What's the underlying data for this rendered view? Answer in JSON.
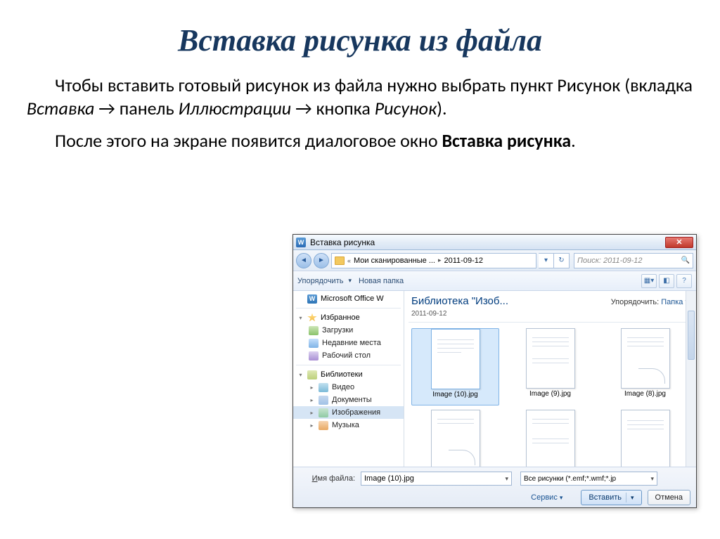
{
  "title": "Вставка рисунка из файла",
  "para1": {
    "t1": "Чтобы вставить готовый рисунок из файла нужно выбрать пункт Рисунок (вкладка ",
    "i1": "Вставка",
    "arrow1": " → панель ",
    "i2": "Иллюстрации",
    "arrow2": " → кнопка ",
    "i3": "Рисунок",
    "t2": ")."
  },
  "para2": {
    "t1": "После этого на экране появится диалоговое окно ",
    "b1": "Вставка рисунка",
    "t2": "."
  },
  "dialog": {
    "title": "Вставка рисунка",
    "path": {
      "crumb1": "Мои сканированные ...",
      "crumb2": "2011-09-12"
    },
    "search_placeholder": "Поиск: 2011-09-12",
    "toolbar": {
      "organize": "Упорядочить",
      "newfolder": "Новая папка"
    },
    "sidebar": {
      "msword": "Microsoft Office W",
      "fav": "Избранное",
      "downloads": "Загрузки",
      "recent": "Недавние места",
      "desktop": "Рабочий стол",
      "libraries": "Библиотеки",
      "video": "Видео",
      "documents": "Документы",
      "images": "Изображения",
      "music": "Музыка"
    },
    "content": {
      "header": "Библиотека \"Изоб...",
      "sub": "2011-09-12",
      "sort_label": "Упорядочить:",
      "sort_value": "Папка"
    },
    "files": [
      "Image (10).jpg",
      "Image (9).jpg",
      "Image (8).jpg",
      "",
      "",
      ""
    ],
    "footer": {
      "fname_label": "Имя файла:",
      "fname_value": "Image (10).jpg",
      "ftype_value": "Все рисунки (*.emf;*.wmf;*.jp",
      "tools": "Сервис",
      "insert": "Вставить",
      "cancel": "Отмена"
    }
  }
}
